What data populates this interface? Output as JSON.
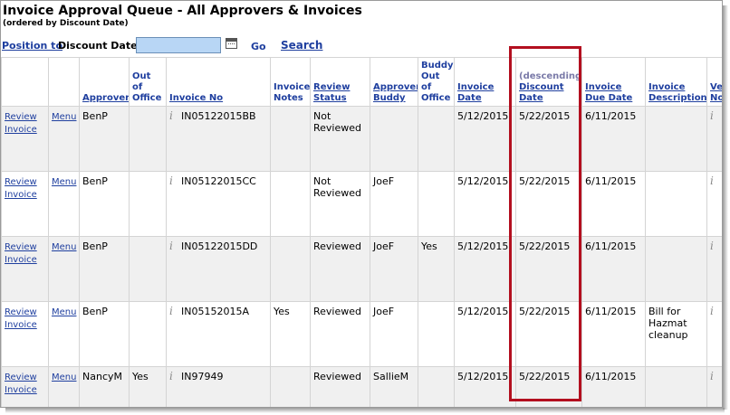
{
  "page": {
    "title": "Invoice Approval Queue - All Approvers & Invoices",
    "subtitle": "(ordered by Discount Date)"
  },
  "position_bar": {
    "link_label": "Position to",
    "field_label": "Discount Date",
    "input_value": "",
    "go_label": "Go",
    "search_label": "Search"
  },
  "columns": {
    "approver": "Approver",
    "out_of_office": "Out of Office",
    "invoice_no": "Invoice No",
    "invoice_notes": "Invoice Notes",
    "review_status": "Review Status",
    "approver_buddy": "Approver Buddy",
    "buddy_out_of_office": "Buddy Out of Office",
    "invoice_date": "Invoice Date",
    "discount_sort_note": "(descending)",
    "discount_date": "Discount Date",
    "invoice_due_date": "Invoice Due Date",
    "invoice_description": "Invoice Description",
    "vendor_no": "Vendor No"
  },
  "row_actions": {
    "review_label": "Review Invoice",
    "menu_label": "Menu",
    "info_icon_glyph": "i"
  },
  "rows": [
    {
      "approver": "BenP",
      "out_of_office": "",
      "invoice_no": "IN05122015BB",
      "invoice_notes": "",
      "review_status": "Not Reviewed",
      "approver_buddy": "",
      "buddy_out_of_office": "",
      "invoice_date": "5/12/2015",
      "discount_date": "5/22/2015",
      "invoice_due_date": "6/11/2015",
      "invoice_description": ""
    },
    {
      "approver": "BenP",
      "out_of_office": "",
      "invoice_no": "IN05122015CC",
      "invoice_notes": "",
      "review_status": "Not Reviewed",
      "approver_buddy": "JoeF",
      "buddy_out_of_office": "",
      "invoice_date": "5/12/2015",
      "discount_date": "5/22/2015",
      "invoice_due_date": "6/11/2015",
      "invoice_description": ""
    },
    {
      "approver": "BenP",
      "out_of_office": "",
      "invoice_no": "IN05122015DD",
      "invoice_notes": "",
      "review_status": "Reviewed",
      "approver_buddy": "JoeF",
      "buddy_out_of_office": "Yes",
      "invoice_date": "5/12/2015",
      "discount_date": "5/22/2015",
      "invoice_due_date": "6/11/2015",
      "invoice_description": ""
    },
    {
      "approver": "BenP",
      "out_of_office": "",
      "invoice_no": "IN05152015A",
      "invoice_notes": "Yes",
      "review_status": "Reviewed",
      "approver_buddy": "JoeF",
      "buddy_out_of_office": "",
      "invoice_date": "5/12/2015",
      "discount_date": "5/22/2015",
      "invoice_due_date": "6/11/2015",
      "invoice_description": "Bill for Hazmat cleanup"
    },
    {
      "approver": "NancyM",
      "out_of_office": "Yes",
      "invoice_no": "IN97949",
      "invoice_notes": "",
      "review_status": "Reviewed",
      "approver_buddy": "SallieM",
      "buddy_out_of_office": "",
      "invoice_date": "5/12/2015",
      "discount_date": "5/22/2015",
      "invoice_due_date": "6/11/2015",
      "invoice_description": ""
    }
  ],
  "colors": {
    "link": "#1f3f9f",
    "highlight_border": "#b30f1f",
    "input_bg": "#b8d6f5"
  }
}
